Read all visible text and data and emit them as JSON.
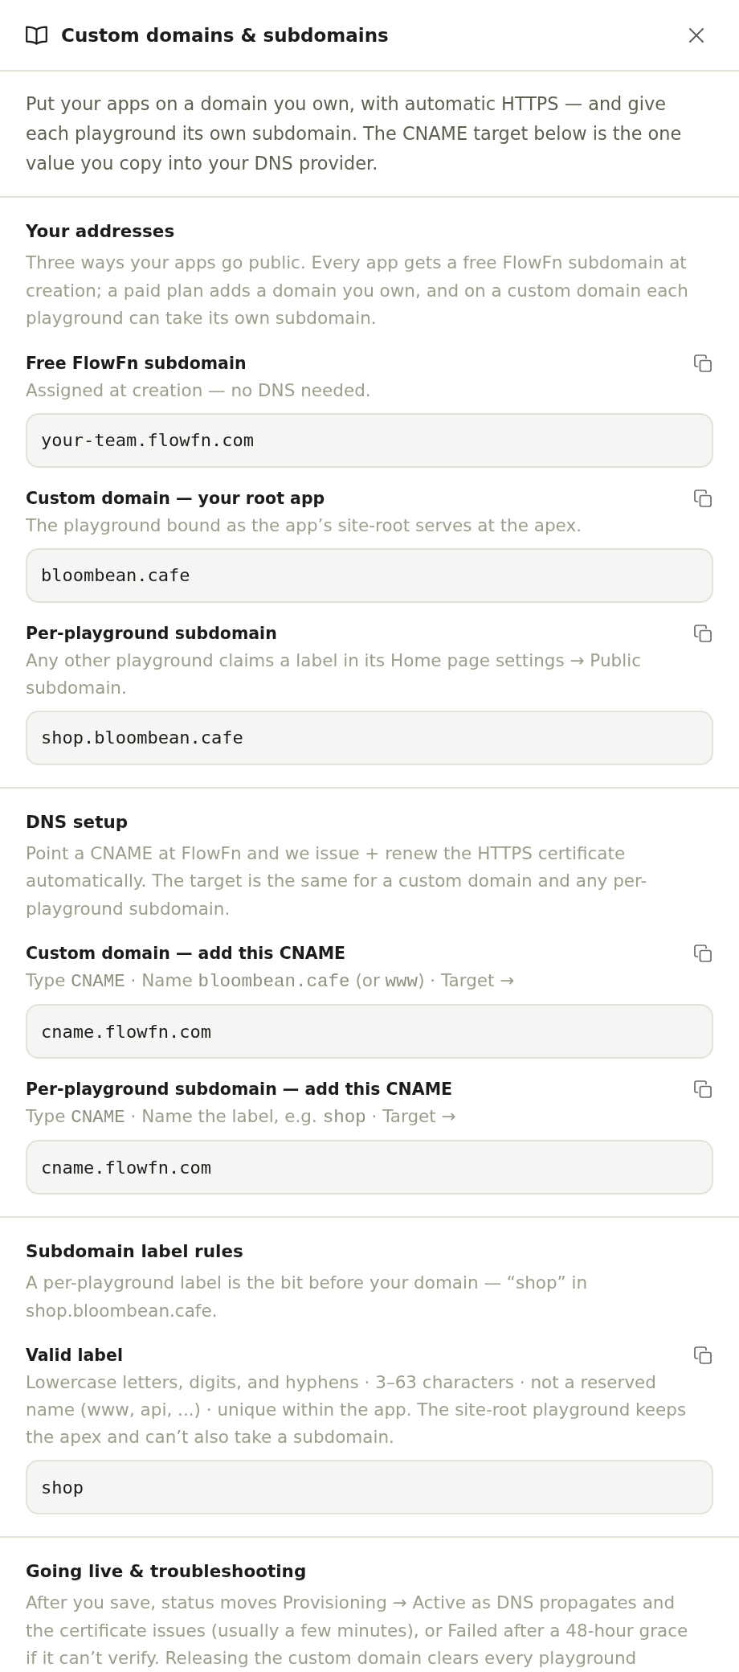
{
  "dialog": {
    "title": "Custom domains & subdomains",
    "intro": "Put your apps on a domain you own, with automatic HTTPS — and give each playground its own subdomain. The CNAME target below is the one value you copy into your DNS provider."
  },
  "sections": [
    {
      "heading": "Your addresses",
      "description": "Three ways your apps go public. Every app gets a free FlowFn subdomain at creation; a paid plan adds a domain you own, and on a custom domain each playground can take its own subdomain.",
      "items": [
        {
          "title": "Free FlowFn subdomain",
          "hint": [
            {
              "kind": "text",
              "text": "Assigned at creation — no DNS needed."
            }
          ],
          "value": "your-team.flowfn.com"
        },
        {
          "title": "Custom domain — your root app",
          "hint": [
            {
              "kind": "text",
              "text": "The playground bound as the app’s site-root serves at the apex."
            }
          ],
          "value": "bloombean.cafe"
        },
        {
          "title": "Per-playground subdomain",
          "hint": [
            {
              "kind": "text",
              "text": "Any other playground claims a label in its Home page settings → Public subdomain."
            }
          ],
          "value": "shop.bloombean.cafe"
        }
      ]
    },
    {
      "heading": "DNS setup",
      "description": "Point a CNAME at FlowFn and we issue + renew the HTTPS certificate automatically. The target is the same for a custom domain and any per-playground subdomain.",
      "items": [
        {
          "title": "Custom domain — add this CNAME",
          "hint": [
            {
              "kind": "text",
              "text": "Type "
            },
            {
              "kind": "code",
              "text": "CNAME"
            },
            {
              "kind": "text",
              "text": " · Name "
            },
            {
              "kind": "code",
              "text": "bloombean.cafe"
            },
            {
              "kind": "text",
              "text": " (or "
            },
            {
              "kind": "code",
              "text": "www"
            },
            {
              "kind": "text",
              "text": ") · Target →"
            }
          ],
          "value": "cname.flowfn.com"
        },
        {
          "title": "Per-playground subdomain — add this CNAME",
          "hint": [
            {
              "kind": "text",
              "text": "Type "
            },
            {
              "kind": "code",
              "text": "CNAME"
            },
            {
              "kind": "text",
              "text": " · Name the label, e.g. "
            },
            {
              "kind": "code",
              "text": "shop"
            },
            {
              "kind": "text",
              "text": " · Target →"
            }
          ],
          "value": "cname.flowfn.com"
        }
      ]
    },
    {
      "heading": "Subdomain label rules",
      "description": "A per-playground label is the bit before your domain — “shop” in shop.bloombean.cafe.",
      "items": [
        {
          "title": "Valid label",
          "hint": [
            {
              "kind": "text",
              "text": "Lowercase letters, digits, and hyphens · 3–63 characters · not a reserved name (www, api, ...) · unique within the app. The site-root playground keeps the apex and can’t also take a subdomain."
            }
          ],
          "value": "shop"
        }
      ]
    },
    {
      "heading": "Going live & troubleshooting",
      "description": "After you save, status moves Provisioning → Active as DNS propagates and the certificate issues (usually a few minutes), or Failed after a 48-hour grace if it can’t verify. Releasing the custom domain clears every playground"
    }
  ]
}
